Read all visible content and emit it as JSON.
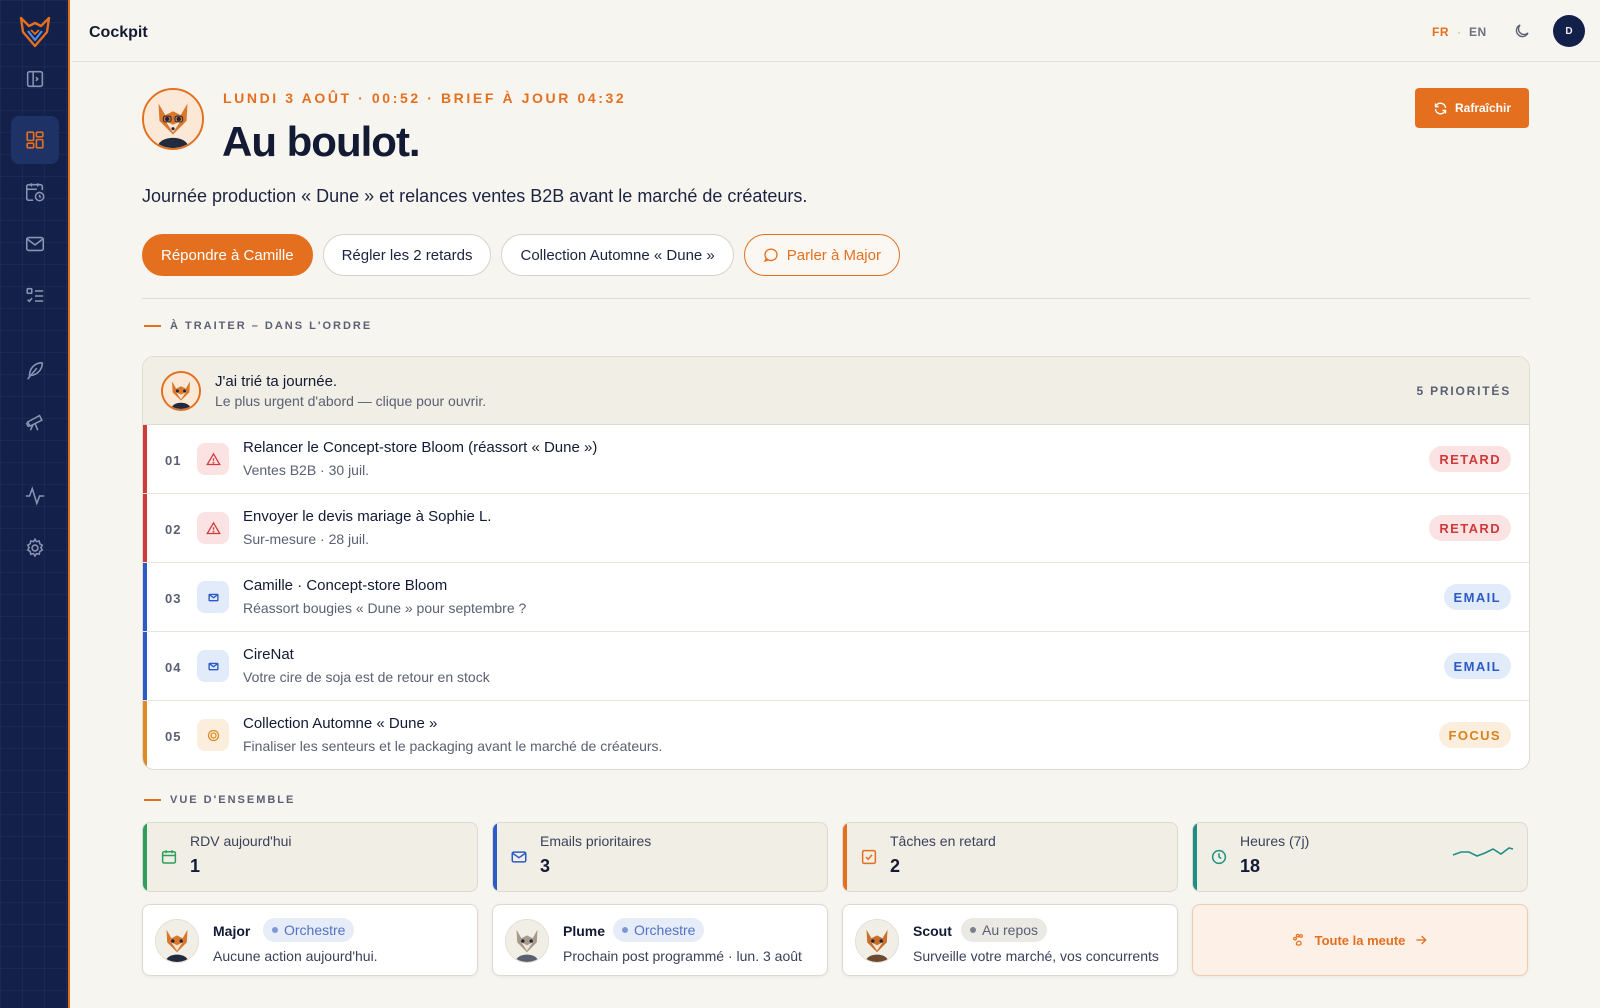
{
  "app": {
    "title": "Cockpit"
  },
  "topbar": {
    "lang_fr": "FR",
    "lang_sep": "·",
    "lang_en": "EN",
    "user_initial": "D"
  },
  "hero": {
    "date_line": "LUNDI 3 AOÛT · 00:52 · BRIEF À JOUR 04:32",
    "title": "Au boulot.",
    "subtitle": "Journée production « Dune » et relances ventes B2B avant le marché de créateurs.",
    "refresh_label": "Rafraîchir"
  },
  "quick_actions": [
    {
      "label": "Répondre à Camille"
    },
    {
      "label": "Régler les 2 retards"
    },
    {
      "label": "Collection Automne « Dune »"
    },
    {
      "label": "Parler à Major"
    }
  ],
  "sections": {
    "todo": "À TRAITER – DANS L'ORDRE",
    "overview": "VUE D'ENSEMBLE"
  },
  "priorities": {
    "header_title": "J'ai trié ta journée.",
    "header_sub": "Le plus urgent d'abord — clique pour ouvrir.",
    "count_label": "5 PRIORITÉS",
    "items": [
      {
        "num": "01",
        "title": "Relancer le Concept-store Bloom (réassort « Dune »)",
        "sub": "Ventes B2B · 30 juil.",
        "badge": "RETARD",
        "kind": "retard"
      },
      {
        "num": "02",
        "title": "Envoyer le devis mariage à Sophie L.",
        "sub": "Sur-mesure · 28 juil.",
        "badge": "RETARD",
        "kind": "retard"
      },
      {
        "num": "03",
        "title": "Camille · Concept-store Bloom",
        "sub": "Réassort bougies « Dune » pour septembre ?",
        "badge": "EMAIL",
        "kind": "email"
      },
      {
        "num": "04",
        "title": "CireNat",
        "sub": "Votre cire de soja est de retour en stock",
        "badge": "EMAIL",
        "kind": "email"
      },
      {
        "num": "05",
        "title": "Collection Automne « Dune »",
        "sub": "Finaliser les senteurs et le packaging avant le marché de créateurs.",
        "badge": "FOCUS",
        "kind": "focus"
      }
    ]
  },
  "stats": [
    {
      "label": "RDV aujourd'hui",
      "value": "1",
      "color": "#2f9e5a"
    },
    {
      "label": "Emails prioritaires",
      "value": "3",
      "color": "#2c5bc8"
    },
    {
      "label": "Tâches en retard",
      "value": "2",
      "color": "#e4701f"
    },
    {
      "label": "Heures (7j)",
      "value": "18",
      "color": "#1f8f83"
    }
  ],
  "agents": [
    {
      "name": "Major",
      "tag": "Orchestre",
      "desc": "Aucune action aujourd'hui."
    },
    {
      "name": "Plume",
      "tag": "Orchestre",
      "desc": "Prochain post programmé · lun. 3 août"
    },
    {
      "name": "Scout",
      "tag": "Au repos",
      "desc": "Surveille votre marché, vos concurrents"
    }
  ],
  "all_agents_label": "Toute la meute",
  "colors": {
    "accent": "#e4701f",
    "navy": "#13204a",
    "danger": "#d13a3a",
    "info": "#2c5bc8"
  },
  "icons": {
    "sidebar": [
      "fox-logo-icon",
      "sidebar-toggle-icon",
      "dashboard-icon",
      "calendar-clock-icon",
      "mail-icon",
      "checklist-icon",
      "feather-icon",
      "telescope-icon",
      "activity-icon",
      "gear-icon"
    ],
    "top": [
      "moon-icon"
    ]
  }
}
